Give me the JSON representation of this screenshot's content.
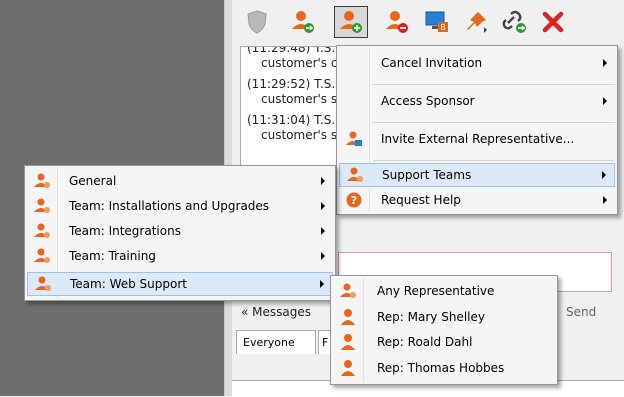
{
  "chat_log": {
    "lines": [
      {
        "time": "(11:29:48) T.S.",
        "sub": "customer's co"
      },
      {
        "time": "(11:29:52) T.S.",
        "sub": "customer's sy"
      },
      {
        "time": "(11:31:04) T.S.",
        "sub": "customer's sy"
      }
    ]
  },
  "chat": {
    "messages_link": "« Messages",
    "send_label": "Send",
    "tabs": [
      "Everyone",
      "F"
    ]
  },
  "toolbar": {
    "icons": [
      "shield-icon",
      "transfer-session-icon",
      "invite-representative-icon",
      "remove-representative-icon",
      "screen-share-icon",
      "pin-icon",
      "link-icon",
      "close-session-icon"
    ]
  },
  "main_menu": {
    "items": [
      {
        "label": "Cancel Invitation",
        "has_submenu": true
      },
      {
        "label": "Access Sponsor",
        "has_submenu": true
      },
      {
        "label": "Invite External Representative...",
        "has_submenu": false,
        "icon": "external-rep-icon"
      },
      {
        "label": "Support Teams",
        "has_submenu": true,
        "icon": "team-icon",
        "highlighted": true
      },
      {
        "label": "Request Help",
        "has_submenu": true,
        "icon": "help-icon"
      }
    ]
  },
  "teams_menu": {
    "items": [
      {
        "label": "General"
      },
      {
        "label": "Team: Installations and Upgrades"
      },
      {
        "label": "Team: Integrations"
      },
      {
        "label": "Team: Training"
      },
      {
        "label": "Team: Web Support",
        "highlighted": true
      }
    ]
  },
  "reps_menu": {
    "items": [
      {
        "label": "Any Representative"
      },
      {
        "label": "Rep: Mary Shelley"
      },
      {
        "label": "Rep: Roald Dahl"
      },
      {
        "label": "Rep: Thomas Hobbes"
      }
    ]
  },
  "colors": {
    "accent_orange": "#e8651a",
    "close_red": "#e0201b",
    "green": "#2e9a2e",
    "highlight": "#dbe9f8"
  }
}
